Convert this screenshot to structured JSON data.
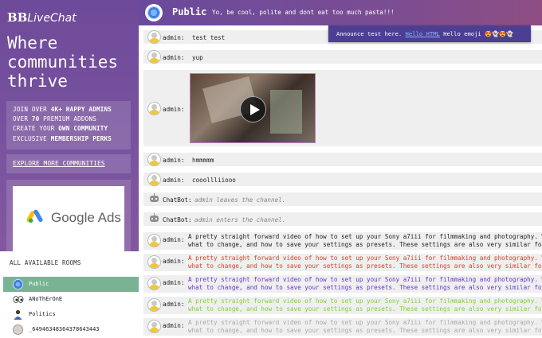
{
  "brand": {
    "bb": "BB",
    "live": "LiveChat"
  },
  "sidebar": {
    "headline": "Where communities thrive",
    "promo": {
      "line1_a": "JOIN OVER ",
      "line1_b": "4K+ HAPPY ADMINS",
      "line2_a": "OVER ",
      "line2_b": "70",
      "line2_c": " PREMIUM ADDONS",
      "line3_a": "CREATE YOUR ",
      "line3_b": "OWN COMMUNITY",
      "line4_a": "EXCLUSIVE ",
      "line4_b": "MEMBERSHIP PERKS"
    },
    "explore": "EXPLORE MORE COMMUNITIES",
    "ad": "Google Ads"
  },
  "rooms": {
    "title": "ALL AVAILABLE ROOMS",
    "items": [
      {
        "label": "Public",
        "active": true
      },
      {
        "label": "ANoThErOnE",
        "active": false
      },
      {
        "label": "Politics",
        "active": false
      },
      {
        "label": "_64946348364378643443",
        "active": false
      }
    ]
  },
  "header": {
    "room_name": "Public",
    "topic": "Yo, be cool, polite and dont eat too much pasta!!!"
  },
  "announcement": {
    "text": "Announce test here. ",
    "link": "Hello HTML",
    "emoji_label": " Hello emoji ",
    "emojis": "😍👻😍👻"
  },
  "messages": [
    {
      "user": "admin:",
      "text": "test test"
    },
    {
      "user": "admin:",
      "text": "yup"
    },
    {
      "user": "admin:",
      "text": ""
    },
    {
      "user": "admin:",
      "text": "hmmmmm"
    },
    {
      "user": "admin:",
      "text": "cooollliiooo"
    },
    {
      "user": "ChatBot:",
      "text": "admin leaves the channel."
    },
    {
      "user": "ChatBot:",
      "text": "admin enters the channel."
    },
    {
      "user": "admin:",
      "line1": "A pretty straight forward video of how to set up your Sony a7iii for filmmaking and photography. We'll go",
      "line2": "what to change, and how to save your settings as presets. These settings are also very similar for other",
      "color": "#222222"
    },
    {
      "user": "admin:",
      "line1": "A pretty straight forward video of how to set up your Sony a7iii for filmmaking and photography. We'll go",
      "line2": "what to change, and how to save your settings as presets. These settings are also very similar for other",
      "color": "#e03a2a"
    },
    {
      "user": "admin:",
      "line1": "A pretty straight forward video of how to set up your Sony a7iii for filmmaking and photography. We'll go",
      "line2": "what to change, and how to save your settings as presets. These settings are also very similar for other",
      "color": "#6a35c9"
    },
    {
      "user": "admin:",
      "line1": "A pretty straight forward video of how to set up your Sony a7iii for filmmaking and photography. We'll go",
      "line2": "what to change, and how to save your settings as presets. These settings are also very similar for other",
      "color": "#7fd13b"
    },
    {
      "user": "admin:",
      "line1": "A pretty straight forward video of how to set up your Sony a7iii for filmmaking and photography. We'll go",
      "line2": "what to change, and how to save your settings as presets. These settings are also very similar for other",
      "color": "#aaaaaa"
    }
  ]
}
